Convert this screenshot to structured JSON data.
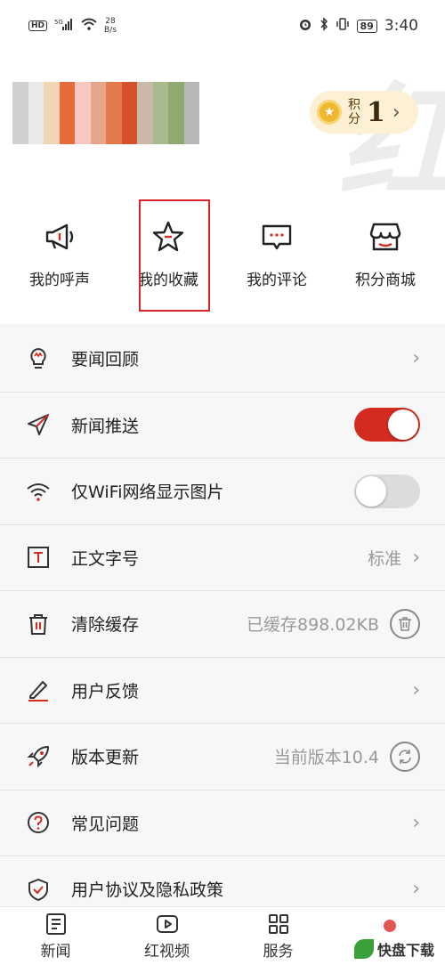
{
  "status_bar": {
    "hd": "HD",
    "signal": "5G",
    "speed_value": "28",
    "speed_unit": "B/s",
    "battery": "89",
    "time": "3:40"
  },
  "header": {
    "points_label": "积分",
    "points_value": "1"
  },
  "actions": [
    {
      "label": "我的呼声",
      "icon": "megaphone-icon"
    },
    {
      "label": "我的收藏",
      "icon": "star-icon"
    },
    {
      "label": "我的评论",
      "icon": "comment-icon"
    },
    {
      "label": "积分商城",
      "icon": "shop-icon"
    }
  ],
  "settings": [
    {
      "label": "要闻回顾",
      "icon": "bulb-icon",
      "value": "",
      "control": "chevron"
    },
    {
      "label": "新闻推送",
      "icon": "send-icon",
      "value": "",
      "control": "toggle",
      "enabled": true
    },
    {
      "label": "仅WiFi网络显示图片",
      "icon": "wifi-icon",
      "value": "",
      "control": "toggle",
      "enabled": false
    },
    {
      "label": "正文字号",
      "icon": "text-size-icon",
      "value": "标准",
      "control": "chevron"
    },
    {
      "label": "清除缓存",
      "icon": "trash-icon",
      "value": "已缓存898.02KB",
      "control": "trash-button"
    },
    {
      "label": "用户反馈",
      "icon": "pen-icon",
      "value": "",
      "control": "chevron"
    },
    {
      "label": "版本更新",
      "icon": "rocket-icon",
      "value": "当前版本10.4",
      "control": "refresh-button"
    },
    {
      "label": "常见问题",
      "icon": "question-icon",
      "value": "",
      "control": "chevron"
    },
    {
      "label": "用户协议及隐私政策",
      "icon": "shield-icon",
      "value": "",
      "control": "chevron"
    }
  ],
  "tabbar": [
    {
      "label": "新闻",
      "icon": "news-icon"
    },
    {
      "label": "红视频",
      "icon": "video-icon"
    },
    {
      "label": "服务",
      "icon": "grid-icon"
    },
    {
      "label": "",
      "icon": "profile-icon"
    }
  ],
  "watermark": {
    "logo_text": "快盘下载"
  },
  "colors": {
    "accent": "#d42b20",
    "points_bg": "#fdf0d4",
    "highlight": "#d9262c"
  }
}
